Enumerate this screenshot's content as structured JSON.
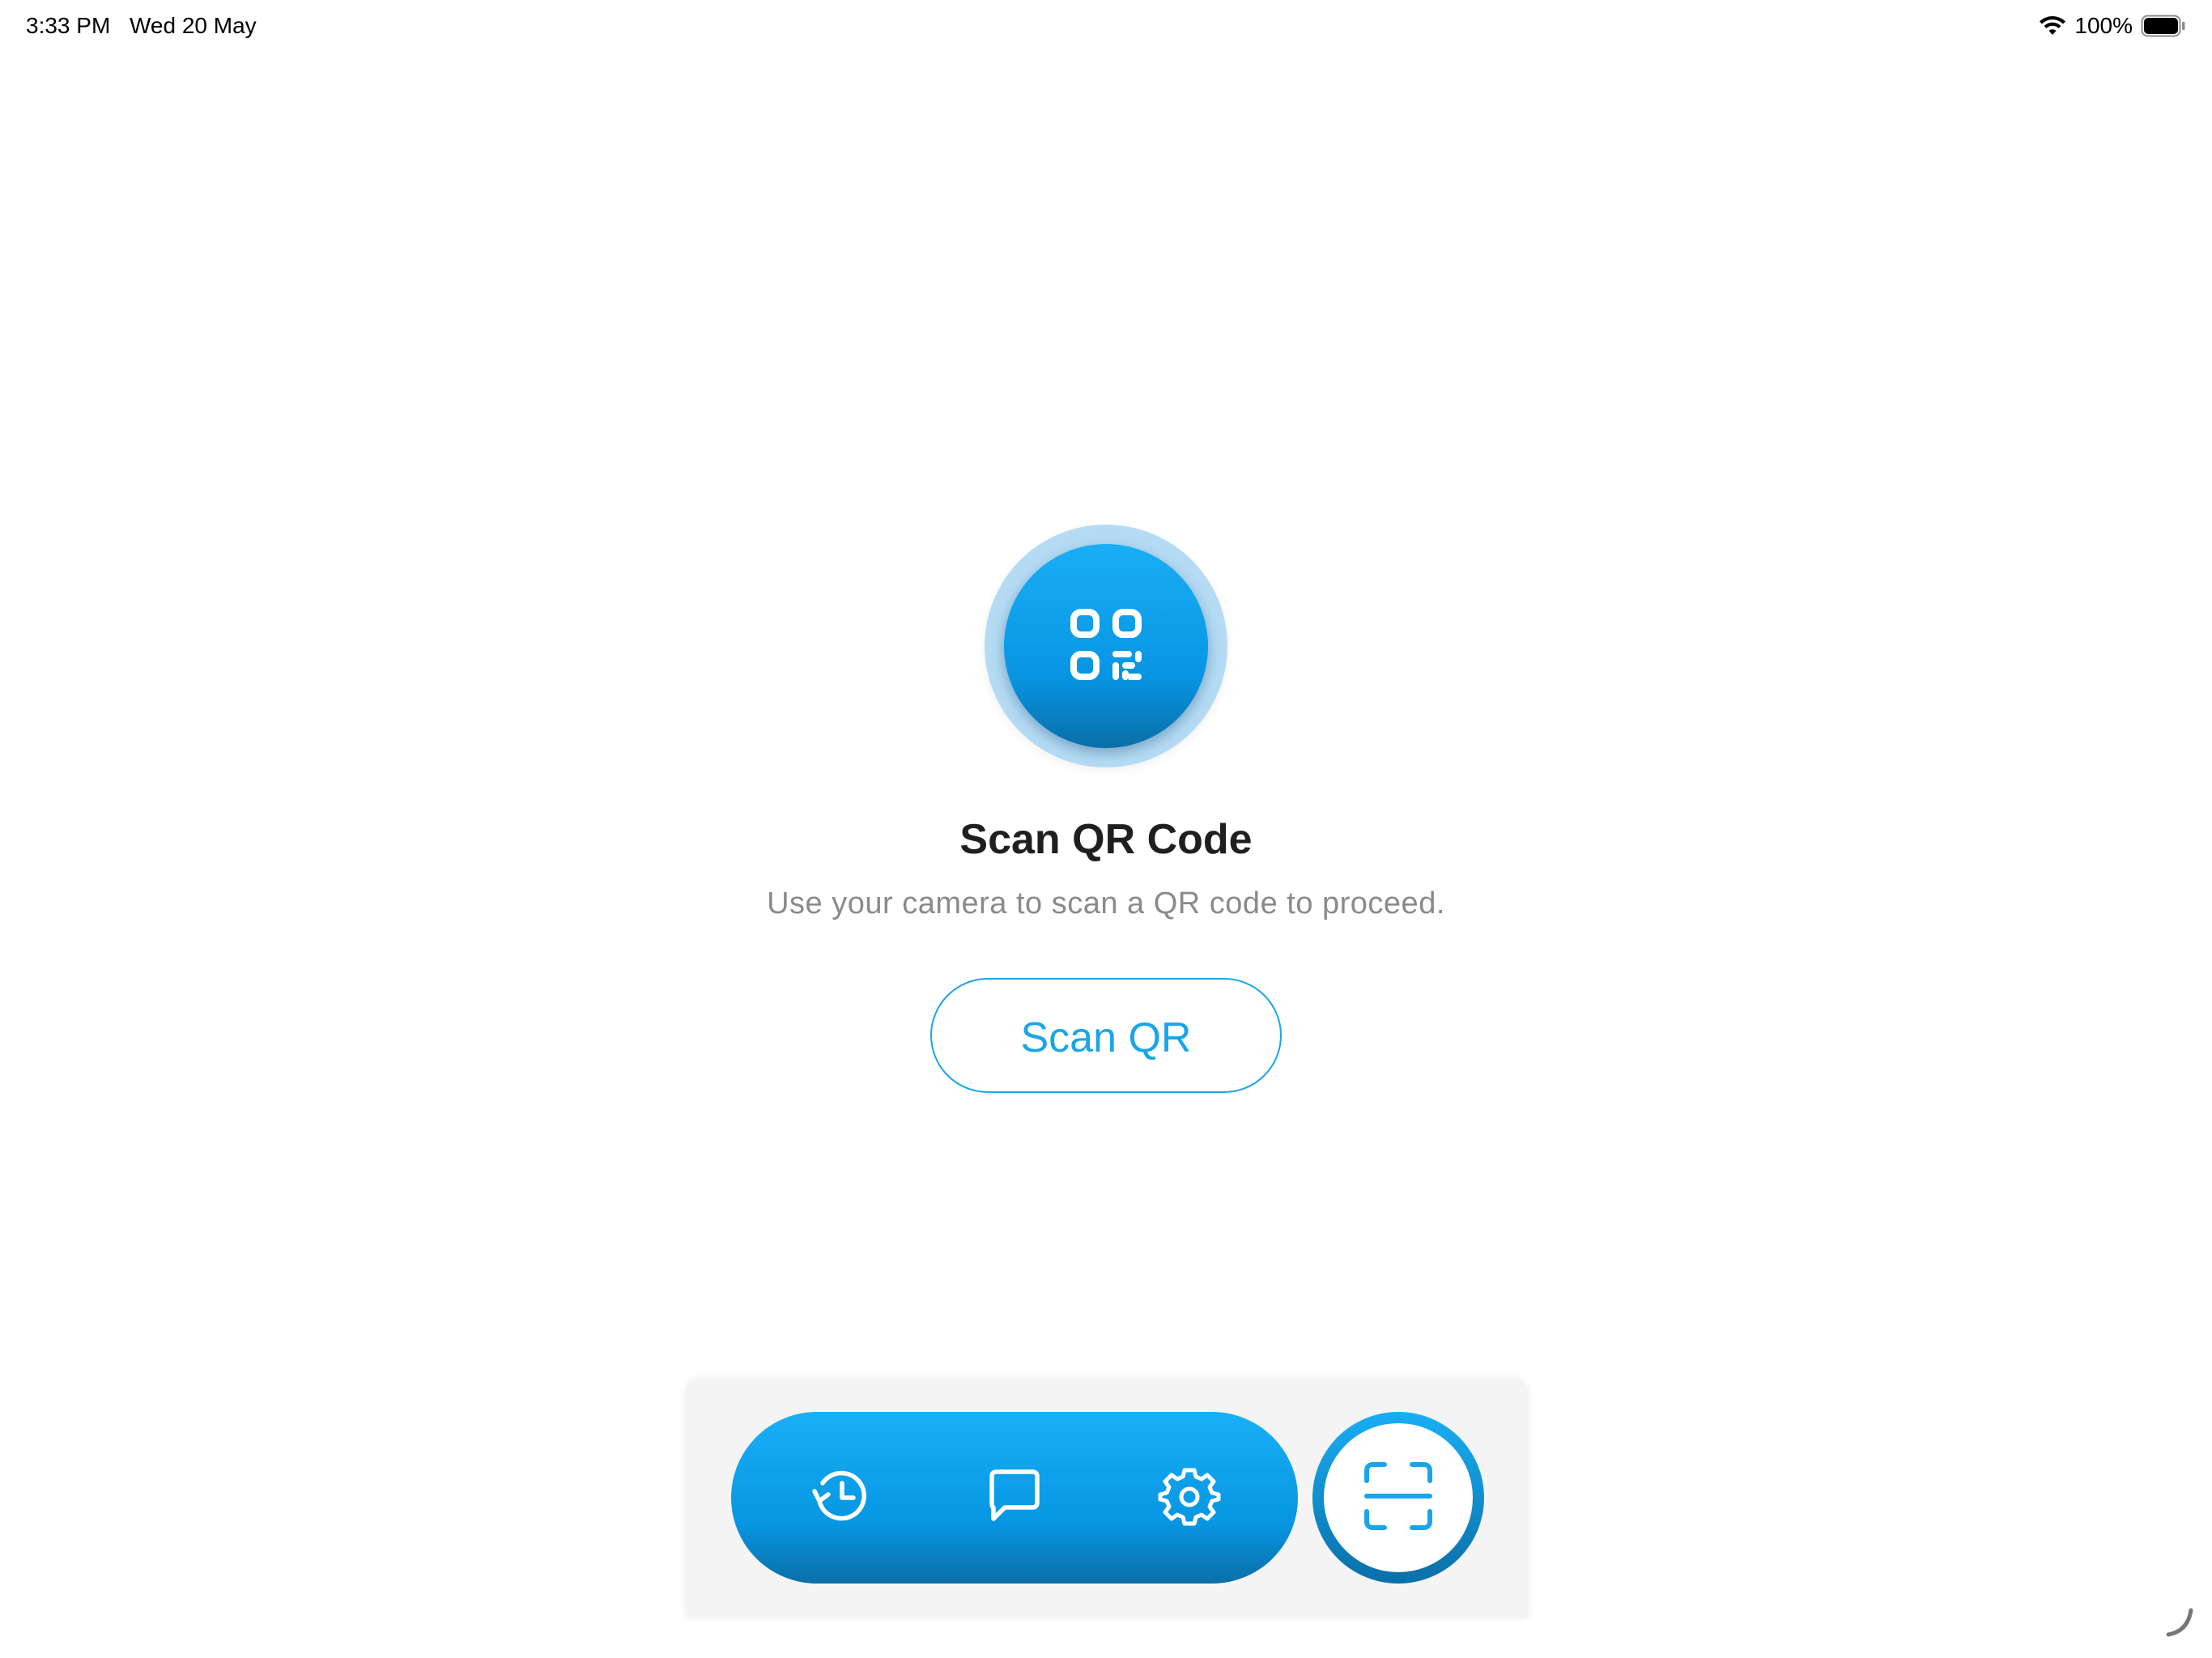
{
  "status_bar": {
    "time": "3:33 PM",
    "date": "Wed 20 May",
    "battery_percent": "100%",
    "icons": [
      "wifi-icon",
      "battery-icon"
    ]
  },
  "main": {
    "hero_icon": "qr-code-icon",
    "title": "Scan QR Code",
    "subtitle": "Use your camera to scan a QR code to proceed.",
    "scan_button_label": "Scan QR"
  },
  "bottom_nav": {
    "items": [
      {
        "id": "history",
        "icon": "history-icon"
      },
      {
        "id": "chat",
        "icon": "chat-bubble-icon"
      },
      {
        "id": "settings",
        "icon": "gear-icon"
      }
    ],
    "fab_icon": "scan-frame-icon"
  },
  "colors": {
    "accent": "#1aa5ea",
    "accent_dark": "#0a6fa7",
    "title": "#1f1f1f",
    "subtitle": "#8a8a8a",
    "nav_panel": "#f4f4f4"
  }
}
